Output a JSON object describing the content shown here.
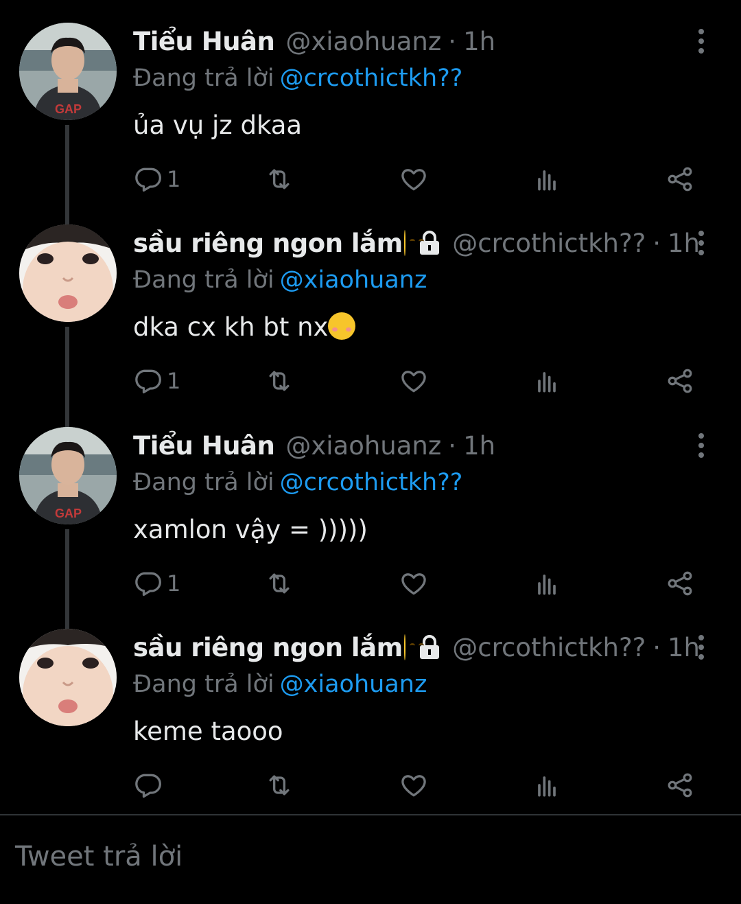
{
  "tweets": [
    {
      "name": "Tiểu Huân",
      "handle": "@xiaohuanz",
      "time": "1h",
      "reply_prefix": "Đang trả lời",
      "reply_to": "@crcothictkh??",
      "text": "ủa vụ jz dkaa",
      "reply_count": "1",
      "avatar": "avatar-hoodie",
      "has_lock": false,
      "name_emoji": "",
      "text_emoji": ""
    },
    {
      "name": "sầu riêng ngon lắm",
      "name_emoji": "yum-face-emoji",
      "has_lock": true,
      "handle": "@crcothictkh??",
      "time": "1h",
      "reply_prefix": "Đang trả lời",
      "reply_to": "@xiaohuanz",
      "text": "dka cx kh bt nx",
      "text_emoji": "smiling-face-emoji",
      "reply_count": "1",
      "avatar": "avatar-closeup"
    },
    {
      "name": "Tiểu Huân",
      "handle": "@xiaohuanz",
      "time": "1h",
      "reply_prefix": "Đang trả lời",
      "reply_to": "@crcothictkh??",
      "text": "xamlon vậy = )))))",
      "reply_count": "1",
      "avatar": "avatar-hoodie",
      "has_lock": false,
      "name_emoji": "",
      "text_emoji": ""
    },
    {
      "name": "sầu riêng ngon lắm",
      "name_emoji": "yum-face-emoji",
      "has_lock": true,
      "handle": "@crcothictkh??",
      "time": "1h",
      "reply_prefix": "Đang trả lời",
      "reply_to": "@xiaohuanz",
      "text": "keme taooo",
      "reply_count": "",
      "avatar": "avatar-closeup",
      "text_emoji": ""
    }
  ],
  "separator_dot": "·",
  "reply_box": {
    "placeholder": "Tweet trả lời"
  },
  "icons": {
    "reply": "reply-icon",
    "retweet": "retweet-icon",
    "like": "heart-icon",
    "views": "views-icon",
    "share": "share-icon",
    "more": "more-icon",
    "lock": "lock-icon"
  },
  "colors": {
    "background": "#000000",
    "text": "#e7e9ea",
    "muted": "#71767b",
    "link": "#1d9bf0",
    "thread_line": "#333639"
  }
}
